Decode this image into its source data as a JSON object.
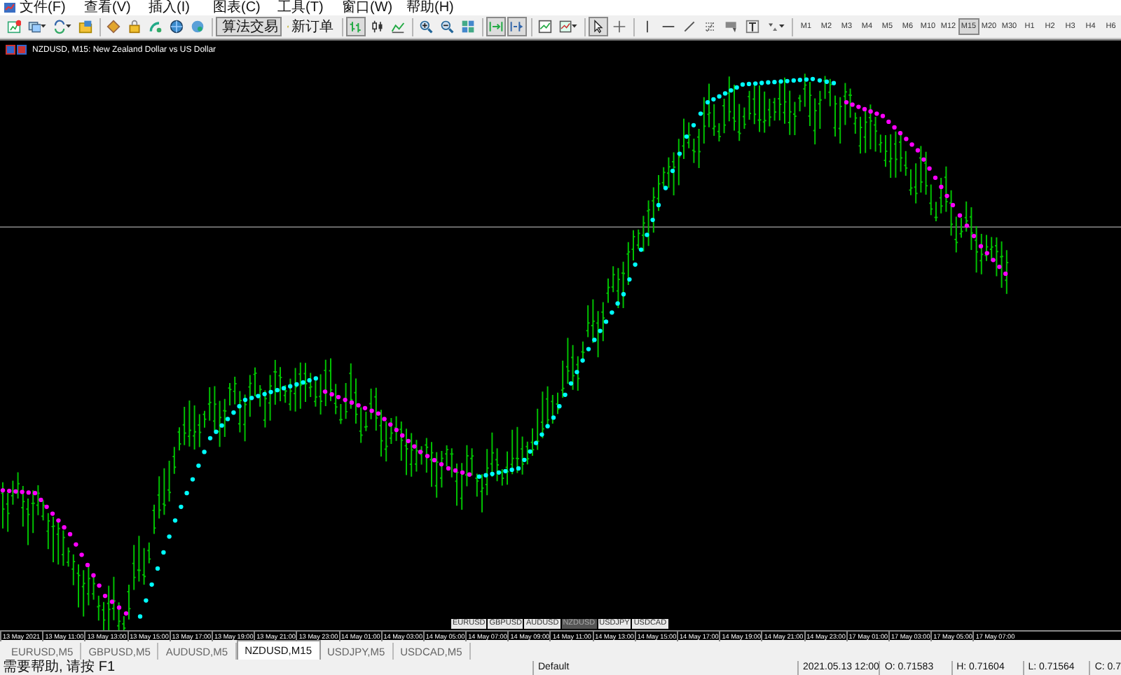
{
  "menu": [
    "文件(F)",
    "查看(V)",
    "插入(I)",
    "图表(C)",
    "工具(T)",
    "窗口(W)",
    "帮助(H)"
  ],
  "toolbar": [
    {
      "kind": "icon"
    },
    {
      "kind": "icon",
      "dropdown": true
    },
    {
      "kind": "icon",
      "dropdown": true
    },
    {
      "kind": "icon"
    },
    {
      "kind": "sep"
    },
    {
      "kind": "icon"
    },
    {
      "kind": "icon"
    },
    {
      "kind": "icon"
    },
    {
      "kind": "icon"
    },
    {
      "kind": "icon"
    },
    {
      "kind": "sep"
    },
    {
      "kind": "text",
      "label": "算法交易",
      "pressed": true
    },
    {
      "kind": "text",
      "label": "新订单",
      "pressed": false
    },
    {
      "kind": "sep"
    },
    {
      "kind": "icon",
      "pressed": true
    },
    {
      "kind": "icon",
      "pressed": false
    },
    {
      "kind": "icon",
      "pressed": false
    },
    {
      "kind": "sep"
    },
    {
      "kind": "icon"
    },
    {
      "kind": "icon"
    },
    {
      "kind": "icon"
    },
    {
      "kind": "sep"
    },
    {
      "kind": "icon",
      "pressed": true
    },
    {
      "kind": "icon",
      "pressed": true
    },
    {
      "kind": "sep"
    },
    {
      "kind": "icon"
    },
    {
      "kind": "icon",
      "dropdown": true
    },
    {
      "kind": "sep"
    },
    {
      "kind": "icon",
      "pressed": true
    },
    {
      "kind": "icon",
      "pressed": false
    },
    {
      "kind": "sep"
    },
    {
      "kind": "icon"
    },
    {
      "kind": "icon"
    },
    {
      "kind": "icon"
    },
    {
      "kind": "icon"
    },
    {
      "kind": "icon"
    },
    {
      "kind": "icon"
    },
    {
      "kind": "icon",
      "dropdown": true
    },
    {
      "kind": "sep"
    }
  ],
  "timeframes": [
    {
      "label": "M1",
      "selected": false
    },
    {
      "label": "M2",
      "selected": false
    },
    {
      "label": "M3",
      "selected": false
    },
    {
      "label": "M4",
      "selected": false
    },
    {
      "label": "M5",
      "selected": false
    },
    {
      "label": "M6",
      "selected": false
    },
    {
      "label": "M10",
      "selected": false
    },
    {
      "label": "M12",
      "selected": false
    },
    {
      "label": "M15",
      "selected": true
    },
    {
      "label": "M20",
      "selected": false
    },
    {
      "label": "M30",
      "selected": false
    },
    {
      "label": "H1",
      "selected": false
    },
    {
      "label": "H2",
      "selected": false
    },
    {
      "label": "H3",
      "selected": false
    },
    {
      "label": "H4",
      "selected": false
    },
    {
      "label": "H6",
      "selected": false
    }
  ],
  "chart": {
    "title": "NZDUSD, M15:  New Zealand Dollar vs US Dollar",
    "symbol_tabs": [
      {
        "label": "EURUSD",
        "selected": false
      },
      {
        "label": "GBPUSD",
        "selected": false
      },
      {
        "label": "AUDUSD",
        "selected": false
      },
      {
        "label": "NZDUSD",
        "selected": true
      },
      {
        "label": "USDJPY",
        "selected": false
      },
      {
        "label": "USDCAD",
        "selected": false
      }
    ],
    "time_axis": [
      "13 May 2021",
      "13 May 11:00",
      "13 May 13:00",
      "13 May 15:00",
      "13 May 17:00",
      "13 May 19:00",
      "13 May 21:00",
      "13 May 23:00",
      "14 May 01:00",
      "14 May 03:00",
      "14 May 05:00",
      "14 May 07:00",
      "14 May 09:00",
      "14 May 11:00",
      "14 May 13:00",
      "14 May 15:00",
      "14 May 17:00",
      "14 May 19:00",
      "14 May 21:00",
      "14 May 23:00",
      "17 May 01:00",
      "17 May 03:00",
      "17 May 05:00",
      "17 May 07:00"
    ]
  },
  "window_tabs": [
    {
      "label": "EURUSD,M5",
      "selected": false
    },
    {
      "label": "GBPUSD,M5",
      "selected": false
    },
    {
      "label": "AUDUSD,M5",
      "selected": false
    },
    {
      "label": "NZDUSD,M15",
      "selected": true
    },
    {
      "label": "USDJPY,M5",
      "selected": false
    },
    {
      "label": "USDCAD,M5",
      "selected": false
    }
  ],
  "status_bar": {
    "help": "需要帮助, 请按 F1",
    "profile": "Default",
    "time": "2021.05.13 12:00",
    "open": "O: 0.71583",
    "high": "H: 0.71604",
    "low": "L: 0.71564",
    "close": "C: 0.7"
  }
}
